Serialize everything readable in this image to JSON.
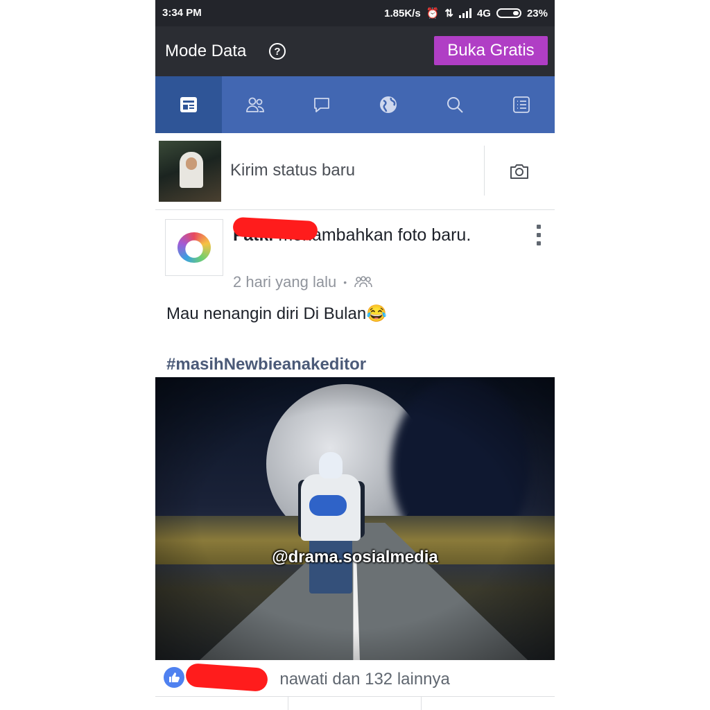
{
  "status_bar": {
    "time": "3:34 PM",
    "speed": "1.85K/s",
    "network": "4G",
    "battery": "23%"
  },
  "mode_bar": {
    "title": "Mode Data",
    "help_icon": "?",
    "free_button": "Buka Gratis",
    "accent_color": "#b03ec5"
  },
  "nav": {
    "tabs": [
      {
        "name": "news-feed",
        "icon": "newsfeed-icon",
        "active": true
      },
      {
        "name": "friends",
        "icon": "friends-icon",
        "active": false
      },
      {
        "name": "messages",
        "icon": "chat-icon",
        "active": false
      },
      {
        "name": "notifications",
        "icon": "globe-icon",
        "active": false
      },
      {
        "name": "search",
        "icon": "search-icon",
        "active": false
      },
      {
        "name": "menu",
        "icon": "list-menu-icon",
        "active": false
      }
    ],
    "bar_color": "#4267b2"
  },
  "composer": {
    "placeholder": "Kirim status baru",
    "camera_icon": "camera-icon"
  },
  "post": {
    "author_visible": "Fatk",
    "author_tail": "i",
    "action": "menambahkan foto baru.",
    "time": "2 hari yang lalu",
    "audience_icon": "friends-icon",
    "text": "Mau nenangin diri  Di Bulan😂",
    "hashtag": "#masihNewbieanakeditor",
    "photo_watermark": "@drama.sosialmedia",
    "reactions": "nawati dan 132 lainnya"
  }
}
